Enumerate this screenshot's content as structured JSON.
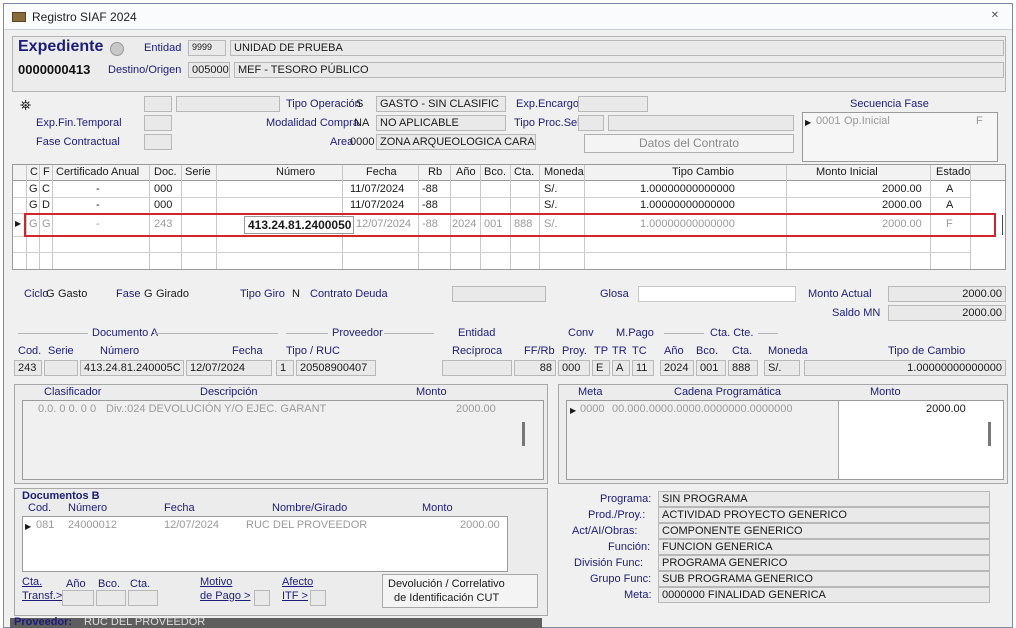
{
  "window": {
    "title": "Registro SIAF 2024",
    "close_glyph": "✕"
  },
  "header": {
    "expediente_label": "Expediente",
    "expediente_value": "0000000413",
    "entidad_label": "Entidad",
    "entidad_code": "9999",
    "entidad_name": "UNIDAD DE PRUEBA",
    "destino_label": "Destino/Origen",
    "destino_code": "005000",
    "destino_name": "MEF - TESORO PÚBLICO"
  },
  "ops": {
    "tipo_operacion_label": "Tipo Operación",
    "tipo_operacion_code": "S",
    "tipo_operacion_desc": "GASTO - SIN CLASIFIC",
    "modalidad_label": "Modalidad Compra",
    "modalidad_code": "NA",
    "modalidad_desc": "NO APLICABLE",
    "area_label": "Area",
    "area_code": "0000",
    "area_desc": "ZONA ARQUEOLOGICA CARAL",
    "exp_fin_label": "Exp.Fin.Temporal",
    "fase_contractual_label": "Fase Contractual",
    "exp_encargo_label": "Exp.Encargo",
    "tipo_proc_label": "Tipo Proc.Sel.",
    "datos_contrato": "Datos del Contrato"
  },
  "secuencia": {
    "title": "Secuencia Fase",
    "code": "0001",
    "text": "Op.Inicial",
    "flag": "F"
  },
  "table": {
    "headers": [
      "C",
      "F",
      "Certificado Anual",
      "Doc.",
      "Serie",
      "Número",
      "Fecha",
      "Rb",
      "Año",
      "Bco.",
      "Cta.",
      "Moneda",
      "Tipo Cambio",
      "Monto Inicial",
      "Estado"
    ],
    "rows": [
      [
        "G",
        "C",
        "-",
        "000",
        "",
        "",
        "11/07/2024",
        "-88",
        "",
        "",
        "",
        "S/.",
        "1.00000000000000",
        "2000.00",
        "A"
      ],
      [
        "G",
        "D",
        "-",
        "000",
        "",
        "",
        "11/07/2024",
        "-88",
        "",
        "",
        "",
        "S/.",
        "1.00000000000000",
        "2000.00",
        "A"
      ],
      [
        "G",
        "G",
        "-",
        "243",
        "",
        "413.24.81.2400050",
        "12/07/2024",
        "-88",
        "2024",
        "001",
        "888",
        "S/.",
        "1.00000000000000",
        "2000.00",
        "F"
      ]
    ]
  },
  "ciclo": {
    "ciclo_label": "Ciclo",
    "ciclo_code": "G",
    "ciclo_text": "Gasto",
    "fase_label": "Fase",
    "fase_code": "G",
    "fase_text": "Girado",
    "tipo_giro_label": "Tipo Giro",
    "tipo_giro_code": "N",
    "contrato_deuda_label": "Contrato Deuda",
    "glosa_label": "Glosa",
    "monto_actual_label": "Monto Actual",
    "monto_actual": "2000.00",
    "saldo_mn_label": "Saldo MN",
    "saldo_mn": "2000.00"
  },
  "docA": {
    "group_title": "Documento A",
    "proveedor_title": "Proveedor",
    "entidad_title": "Entidad",
    "conv_title": "Conv",
    "mpago_title": "M.Pago",
    "ctacte_title": "Cta. Cte.",
    "headers": [
      "Cod.",
      "Serie",
      "Número",
      "Fecha",
      "Tipo / RUC",
      "Recíproca",
      "FF/Rb",
      "Proy.",
      "TP",
      "TR",
      "TC",
      "Año",
      "Bco.",
      "Cta.",
      "Moneda",
      "Tipo de Cambio"
    ],
    "values": {
      "cod": "243",
      "numero": "413.24.81.240005C",
      "fecha": "12/07/2024",
      "tipo": "1",
      "ruc": "20508900407",
      "ffrb": "88",
      "proy": "000",
      "tp": "E",
      "tr": "A",
      "tc": "11",
      "anio": "2024",
      "bco": "001",
      "cta": "888",
      "moneda": "S/.",
      "tipo_cambio": "1.00000000000000"
    }
  },
  "clasificador": {
    "headers": [
      "Clasificador",
      "Descripción",
      "Monto"
    ],
    "row": {
      "code": "0.0. 0 0. 0 0",
      "desc": "Div.:024 DEVOLUCIÓN Y/O EJEC. GARANT",
      "monto": "2000.00"
    }
  },
  "meta": {
    "headers": [
      "Meta",
      "Cadena Programática",
      "Monto"
    ],
    "row": {
      "code": "0000",
      "cadena": "00.000.0000.0000.0000000.0000000",
      "monto": "2000.00"
    }
  },
  "docsB": {
    "title": "Documentos B",
    "headers": [
      "Cod.",
      "Número",
      "Fecha",
      "Nombre/Girado",
      "Monto"
    ],
    "row": {
      "cod": "081",
      "numero": "24000012",
      "fecha": "12/07/2024",
      "nombre": "RUC DEL PROVEEDOR",
      "monto": "2000.00"
    },
    "links": {
      "cta_transf_1": "Cta.",
      "cta_transf_2": "Transf.>",
      "anio": "Año",
      "bco": "Bco.",
      "cta": "Cta.",
      "motivo_1": "Motivo",
      "motivo_2": "de Pago >",
      "afecto_1": "Afecto",
      "afecto_2": "ITF >"
    },
    "devolucion_1": "Devolución / Correlativo",
    "devolucion_2": "de Identificación CUT"
  },
  "programa": {
    "items": [
      {
        "label": "Programa:",
        "value": "SIN PROGRAMA"
      },
      {
        "label": "Prod./Proy.:",
        "value": "ACTIVIDAD PROYECTO GENERICO"
      },
      {
        "label": "Act/AI/Obras:",
        "value": "COMPONENTE GENERICO"
      },
      {
        "label": "Función:",
        "value": "FUNCION GENERICA"
      },
      {
        "label": "División Func:",
        "value": "PROGRAMA GENERICO"
      },
      {
        "label": "Grupo Func:",
        "value": "SUB PROGRAMA GENERICO"
      },
      {
        "label": "Meta:",
        "value": "0000000 FINALIDAD GENERICA"
      }
    ]
  },
  "footer": {
    "proveedor_label": "Proveedor:",
    "proveedor_value": "RUC DEL PROVEEDOR"
  },
  "colors": {
    "highlight": "#d0262b",
    "title_blue": "#1c1c7c",
    "footer_bar": "#606060"
  }
}
